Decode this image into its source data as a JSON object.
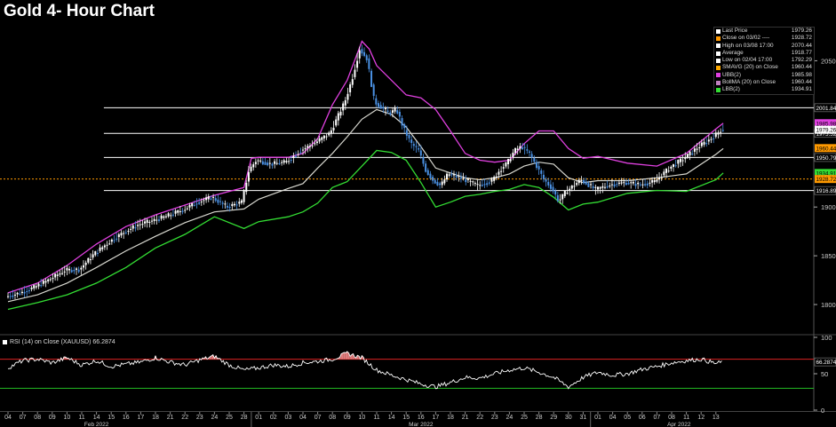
{
  "title": "Gold 4- Hour Chart",
  "colors": {
    "background": "#000000",
    "candle": "#ffffff",
    "candle_down": "#4a90e2",
    "upper_band": "#e040e0",
    "lower_band": "#33dd33",
    "moving_average": "#d8d8d0",
    "close_line": "#ff9900",
    "level_line": "#ffffff",
    "rsi_line": "#ffffff",
    "rsi_overbought": "#dd2222",
    "rsi_oversold": "#22bb22",
    "rsi_fill": "#e58080"
  },
  "legend": [
    {
      "label": "Last Price",
      "value": "1979.26",
      "color": "#ffffff",
      "icon": "square-icon"
    },
    {
      "label": "Close on 03/02 ----",
      "value": "1928.72",
      "color": "#ff9900",
      "icon": "square-icon"
    },
    {
      "label": "High on 03/08 17:00",
      "value": "2070.44",
      "color": "#ffffff",
      "icon": "caret-up-icon"
    },
    {
      "label": "Average",
      "value": "1918.77",
      "color": "#ffffff",
      "icon": "dash-icon"
    },
    {
      "label": "Low on 02/04 17:00",
      "value": "1792.29",
      "color": "#ffffff",
      "icon": "caret-down-icon"
    },
    {
      "label": "SMAVG (20)  on Close",
      "value": "1960.44",
      "color": "#ffaa00",
      "icon": "square-icon"
    },
    {
      "label": "UBB(2)",
      "value": "1985.98",
      "color": "#e040e0",
      "icon": "square-icon"
    },
    {
      "label": "BollMA (20)  on Close",
      "value": "1960.44",
      "color": "#c080c0",
      "icon": "square-icon"
    },
    {
      "label": "LBB(2)",
      "value": "1934.91",
      "color": "#33dd33",
      "icon": "square-icon"
    }
  ],
  "rsi": {
    "label": "RSI (14)  on Close (XAUUSD)",
    "value": "66.2874",
    "value_num": 66.2874,
    "overbought": 70,
    "oversold": 30,
    "axis_ticks": [
      "100",
      "50",
      "0"
    ]
  },
  "chart_data": {
    "type": "candlestick",
    "title": "Gold 4- Hour Chart",
    "ylim": [
      1770,
      2085
    ],
    "y_ticks": [
      1800,
      1850,
      1900,
      1950,
      2050
    ],
    "y_tick_labels": [
      "1800",
      "1850",
      "1900",
      "1950",
      "2050"
    ],
    "horizontal_levels": [
      {
        "value": 2001.84,
        "label": "2001.84",
        "color": "#ffffff"
      },
      {
        "value": 1975.52,
        "label": "1975.52",
        "color": "#ffffff"
      },
      {
        "value": 1950.79,
        "label": "1950.79",
        "color": "#ffffff"
      },
      {
        "value": 1916.89,
        "label": "1916.89",
        "color": "#ffffff"
      }
    ],
    "close_reference": {
      "value": 1928.72,
      "label": "1928.72",
      "color": "#ff9900"
    },
    "right_value_tags": [
      {
        "value": 1985.98,
        "label": "1985.98",
        "color": "#e040e0"
      },
      {
        "value": 1979.26,
        "label": "1979.26",
        "color": "#ffffff"
      },
      {
        "value": 1960.44,
        "label": "1960.44",
        "color": "#ff9900"
      },
      {
        "value": 1934.91,
        "label": "1934.91",
        "color": "#33dd33"
      }
    ],
    "x_tick_labels": [
      "04",
      "07",
      "08",
      "09",
      "10",
      "11",
      "14",
      "15",
      "16",
      "17",
      "18",
      "21",
      "22",
      "23",
      "24",
      "25",
      "28",
      "01",
      "02",
      "03",
      "04",
      "07",
      "08",
      "09",
      "10",
      "11",
      "14",
      "15",
      "16",
      "17",
      "18",
      "21",
      "22",
      "23",
      "24",
      "25",
      "28",
      "29",
      "30",
      "31",
      "01",
      "04",
      "05",
      "06",
      "07",
      "08",
      "11",
      "12",
      "13"
    ],
    "month_labels": [
      {
        "label": "Feb 2022",
        "day_index": 6
      },
      {
        "label": "Mar 2022",
        "day_index": 28
      },
      {
        "label": "Apr 2022",
        "day_index": 45.5
      }
    ],
    "month_separators": [
      16.5,
      39.5
    ],
    "price_path": [
      [
        0,
        1808
      ],
      [
        1,
        1812
      ],
      [
        2,
        1818
      ],
      [
        3,
        1826
      ],
      [
        4,
        1835
      ],
      [
        5,
        1836
      ],
      [
        6,
        1852
      ],
      [
        7,
        1864
      ],
      [
        8,
        1874
      ],
      [
        9,
        1882
      ],
      [
        10,
        1886
      ],
      [
        11,
        1891
      ],
      [
        12,
        1897
      ],
      [
        13,
        1905
      ],
      [
        14,
        1910
      ],
      [
        15,
        1900
      ],
      [
        16,
        1905
      ],
      [
        16.5,
        1938
      ],
      [
        17,
        1948
      ],
      [
        18,
        1944
      ],
      [
        19,
        1946
      ],
      [
        20,
        1958
      ],
      [
        21,
        1966
      ],
      [
        22,
        1976
      ],
      [
        22.5,
        1992
      ],
      [
        23,
        2008
      ],
      [
        23.5,
        2032
      ],
      [
        24,
        2062
      ],
      [
        24.5,
        2052
      ],
      [
        25,
        2008
      ],
      [
        26,
        1996
      ],
      [
        26.5,
        2000
      ],
      [
        27,
        1980
      ],
      [
        27.5,
        1965
      ],
      [
        28,
        1958
      ],
      [
        28.5,
        1937
      ],
      [
        29,
        1927
      ],
      [
        29.5,
        1922
      ],
      [
        30,
        1934
      ],
      [
        31,
        1929
      ],
      [
        32,
        1922
      ],
      [
        33,
        1927
      ],
      [
        33.5,
        1938
      ],
      [
        34,
        1945
      ],
      [
        34.5,
        1958
      ],
      [
        35,
        1962
      ],
      [
        35.5,
        1955
      ],
      [
        36,
        1942
      ],
      [
        36.5,
        1928
      ],
      [
        37,
        1920
      ],
      [
        37.5,
        1906
      ],
      [
        38,
        1916
      ],
      [
        39,
        1928
      ],
      [
        40,
        1918
      ],
      [
        41,
        1923
      ],
      [
        42,
        1925
      ],
      [
        43,
        1923
      ],
      [
        44,
        1926
      ],
      [
        45,
        1940
      ],
      [
        46,
        1950
      ],
      [
        47,
        1962
      ],
      [
        48,
        1972
      ],
      [
        48.5,
        1979.26
      ]
    ],
    "upper_band": [
      [
        0,
        1812
      ],
      [
        2,
        1822
      ],
      [
        4,
        1840
      ],
      [
        6,
        1862
      ],
      [
        8,
        1880
      ],
      [
        10,
        1892
      ],
      [
        12,
        1902
      ],
      [
        14,
        1912
      ],
      [
        16,
        1920
      ],
      [
        16.5,
        1950
      ],
      [
        17,
        1951
      ],
      [
        19,
        1951
      ],
      [
        20,
        1955
      ],
      [
        21,
        1970
      ],
      [
        22,
        2005
      ],
      [
        23,
        2030
      ],
      [
        24,
        2070
      ],
      [
        24.5,
        2062
      ],
      [
        25,
        2045
      ],
      [
        27,
        2015
      ],
      [
        28,
        2012
      ],
      [
        29,
        2000
      ],
      [
        30,
        1978
      ],
      [
        31,
        1955
      ],
      [
        32,
        1948
      ],
      [
        33,
        1946
      ],
      [
        34,
        1948
      ],
      [
        35,
        1965
      ],
      [
        36,
        1978
      ],
      [
        37,
        1978
      ],
      [
        38,
        1960
      ],
      [
        39,
        1950
      ],
      [
        40,
        1952
      ],
      [
        42,
        1945
      ],
      [
        44,
        1942
      ],
      [
        46,
        1955
      ],
      [
        48,
        1980
      ],
      [
        48.5,
        1986
      ]
    ],
    "lower_band": [
      [
        0,
        1795
      ],
      [
        2,
        1802
      ],
      [
        4,
        1810
      ],
      [
        6,
        1822
      ],
      [
        8,
        1838
      ],
      [
        10,
        1858
      ],
      [
        12,
        1872
      ],
      [
        14,
        1890
      ],
      [
        16,
        1878
      ],
      [
        17,
        1885
      ],
      [
        19,
        1890
      ],
      [
        20,
        1895
      ],
      [
        21,
        1904
      ],
      [
        22,
        1920
      ],
      [
        23,
        1926
      ],
      [
        24,
        1942
      ],
      [
        25,
        1958
      ],
      [
        26,
        1956
      ],
      [
        27,
        1948
      ],
      [
        28,
        1925
      ],
      [
        29,
        1900
      ],
      [
        30,
        1905
      ],
      [
        31,
        1911
      ],
      [
        32,
        1913
      ],
      [
        33,
        1916
      ],
      [
        34,
        1918
      ],
      [
        35,
        1923
      ],
      [
        36,
        1920
      ],
      [
        37,
        1910
      ],
      [
        38,
        1897
      ],
      [
        39,
        1903
      ],
      [
        40,
        1905
      ],
      [
        42,
        1914
      ],
      [
        44,
        1917
      ],
      [
        46,
        1916
      ],
      [
        48,
        1928
      ],
      [
        48.5,
        1935
      ]
    ],
    "moving_average": [
      [
        0,
        1803
      ],
      [
        2,
        1810
      ],
      [
        4,
        1822
      ],
      [
        6,
        1838
      ],
      [
        8,
        1855
      ],
      [
        10,
        1870
      ],
      [
        12,
        1884
      ],
      [
        14,
        1895
      ],
      [
        16,
        1898
      ],
      [
        17,
        1908
      ],
      [
        19,
        1919
      ],
      [
        20,
        1924
      ],
      [
        21,
        1940
      ],
      [
        22,
        1955
      ],
      [
        23,
        1972
      ],
      [
        24,
        1990
      ],
      [
        25,
        2000
      ],
      [
        26,
        1995
      ],
      [
        27,
        1982
      ],
      [
        28,
        1962
      ],
      [
        29,
        1940
      ],
      [
        30,
        1935
      ],
      [
        31,
        1930
      ],
      [
        32,
        1928
      ],
      [
        33,
        1930
      ],
      [
        34,
        1934
      ],
      [
        35,
        1942
      ],
      [
        36,
        1946
      ],
      [
        37,
        1944
      ],
      [
        38,
        1930
      ],
      [
        39,
        1925
      ],
      [
        40,
        1927
      ],
      [
        42,
        1927
      ],
      [
        44,
        1930
      ],
      [
        46,
        1934
      ],
      [
        48,
        1954
      ],
      [
        48.5,
        1960
      ]
    ],
    "rsi_path": [
      [
        0,
        58
      ],
      [
        1,
        68
      ],
      [
        2,
        70
      ],
      [
        3,
        65
      ],
      [
        4,
        72
      ],
      [
        5,
        62
      ],
      [
        6,
        68
      ],
      [
        7,
        60
      ],
      [
        8,
        63
      ],
      [
        9,
        66
      ],
      [
        10,
        72
      ],
      [
        11,
        66
      ],
      [
        12,
        62
      ],
      [
        13,
        69
      ],
      [
        14,
        74
      ],
      [
        15,
        62
      ],
      [
        16,
        55
      ],
      [
        17,
        58
      ],
      [
        18,
        62
      ],
      [
        19,
        60
      ],
      [
        20,
        65
      ],
      [
        21,
        67
      ],
      [
        22,
        70
      ],
      [
        23,
        78
      ],
      [
        24,
        72
      ],
      [
        25,
        55
      ],
      [
        26,
        48
      ],
      [
        27,
        42
      ],
      [
        28,
        36
      ],
      [
        29,
        32
      ],
      [
        30,
        38
      ],
      [
        31,
        45
      ],
      [
        32,
        44
      ],
      [
        33,
        50
      ],
      [
        34,
        55
      ],
      [
        35,
        58
      ],
      [
        36,
        52
      ],
      [
        37,
        45
      ],
      [
        38,
        32
      ],
      [
        39,
        45
      ],
      [
        40,
        52
      ],
      [
        41,
        48
      ],
      [
        42,
        50
      ],
      [
        43,
        56
      ],
      [
        44,
        60
      ],
      [
        45,
        65
      ],
      [
        46,
        68
      ],
      [
        47,
        70
      ],
      [
        48,
        64
      ],
      [
        48.5,
        66.29
      ]
    ]
  }
}
